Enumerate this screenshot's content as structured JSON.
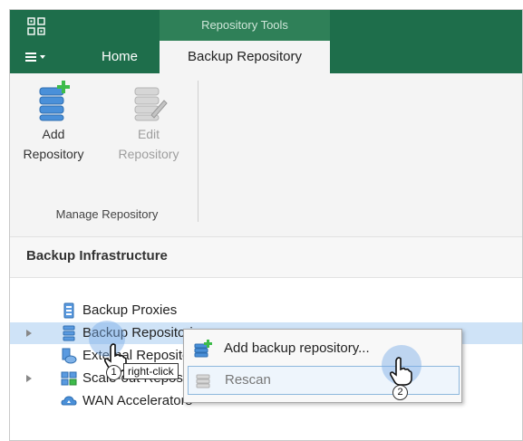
{
  "ribbon": {
    "context_group_label": "Repository Tools",
    "tabs": [
      {
        "label": "Home"
      },
      {
        "label": "Backup Repository"
      }
    ],
    "buttons": [
      {
        "line1": "Add",
        "line2": "Repository",
        "enabled": true,
        "icon": "add-repository-icon"
      },
      {
        "line1": "Edit",
        "line2": "Repository",
        "enabled": false,
        "icon": "edit-repository-icon"
      }
    ],
    "group_label": "Manage Repository"
  },
  "panel": {
    "title": "Backup Infrastructure"
  },
  "tree": {
    "items": [
      {
        "label": "Backup Proxies",
        "icon": "backup-proxy-icon",
        "expandable": false
      },
      {
        "label": "Backup Repositories",
        "icon": "backup-repository-icon",
        "expandable": true,
        "selected": true
      },
      {
        "label": "External Repositories",
        "icon": "external-repository-icon",
        "expandable": false
      },
      {
        "label": "Scale-out Repositories",
        "icon": "scale-out-repository-icon",
        "expandable": true
      },
      {
        "label": "WAN Accelerators",
        "icon": "wan-accelerator-icon",
        "expandable": false
      }
    ]
  },
  "context_menu": {
    "items": [
      {
        "label": "Add backup repository...",
        "enabled": true,
        "icon": "add-repository-icon"
      },
      {
        "label": "Rescan",
        "enabled": false,
        "icon": "rescan-icon"
      }
    ]
  },
  "annotations": {
    "step1_number": "1",
    "step1_text": "right-click",
    "step2_number": "2"
  },
  "colors": {
    "ribbon_green": "#1e6e4b",
    "context_green": "#2f8058",
    "selection_blue": "#cfe3f7",
    "highlight_blue": "#78aae6"
  }
}
